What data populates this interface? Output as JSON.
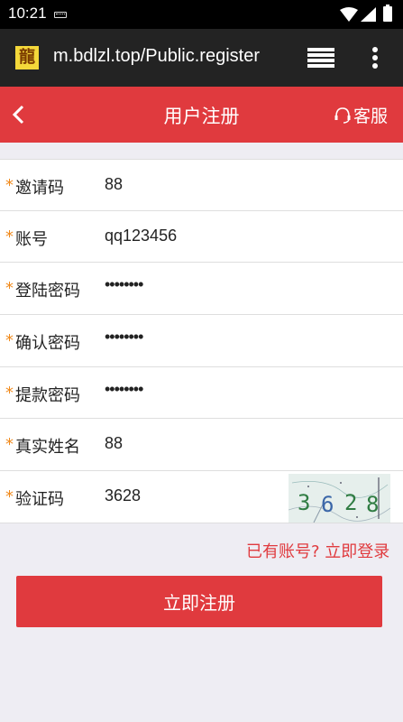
{
  "status_bar": {
    "time": "10:21"
  },
  "browser": {
    "favicon_glyph": "龍",
    "url": "m.bdlzl.top/Public.register"
  },
  "header": {
    "title": "用户注册",
    "service_label": "客服"
  },
  "form": {
    "required_mark": "*",
    "rows": [
      {
        "label": "邀请码",
        "value": "88"
      },
      {
        "label": "账号",
        "value": "qq123456"
      },
      {
        "label": "登陆密码",
        "value": "••••••••"
      },
      {
        "label": "确认密码",
        "value": "••••••••"
      },
      {
        "label": "提款密码",
        "value": "••••••••"
      },
      {
        "label": "真实姓名",
        "value": "88"
      },
      {
        "label": "验证码",
        "value": "3628"
      }
    ],
    "captcha_text": "3628"
  },
  "login_link": "已有账号? 立即登录",
  "submit_label": "立即注册",
  "colors": {
    "primary": "#e03a3e",
    "required": "#f08a1c",
    "background": "#eeedf3"
  }
}
